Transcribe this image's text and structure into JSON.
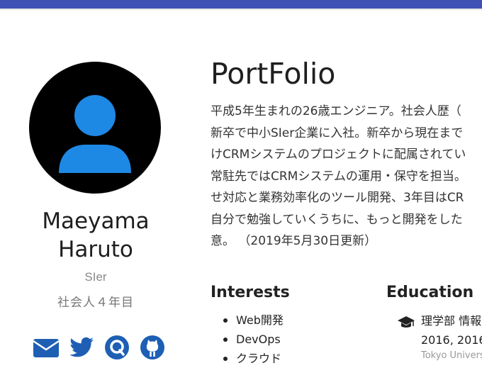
{
  "header": {
    "bar_color": "#3f51b5"
  },
  "profile": {
    "avatar_icon": "user-icon",
    "avatar_bg": "#000000",
    "avatar_fg": "#1e88e5",
    "name_line1": "Maeyama",
    "name_line2": "Haruto",
    "role": "SIer",
    "years": "社会人４年目",
    "social": [
      {
        "name": "email",
        "icon": "envelope-icon",
        "color": "#1e5fb4"
      },
      {
        "name": "twitter",
        "icon": "twitter-icon",
        "color": "#1e5fb4"
      },
      {
        "name": "qiita",
        "icon": "qiita-icon",
        "color": "#1e5fb4"
      },
      {
        "name": "github",
        "icon": "github-icon",
        "color": "#1e5fb4"
      }
    ]
  },
  "main": {
    "title": "PortFolio",
    "bio_lines": [
      "平成5年生まれの26歳エンジニア。社会人歴（",
      "新卒で中小SIer企業に入社。新卒から現在まで",
      "けCRMシステムのプロジェクトに配属されてい",
      "常駐先ではCRMシステムの運用・保守を担当。",
      "せ対応と業務効率化のツール開発、3年目はCR",
      "自分で勉強していくうちに、もっと開発をした",
      "意。 （2019年5月30日更新）"
    ]
  },
  "interests": {
    "title": "Interests",
    "items": [
      "Web開発",
      "DevOps",
      "クラウド"
    ]
  },
  "education": {
    "title": "Education",
    "icon": "graduation-cap-icon",
    "line1": "理学部 情報",
    "line2": "2016, 2016",
    "line3": "Tokyo Universit"
  }
}
